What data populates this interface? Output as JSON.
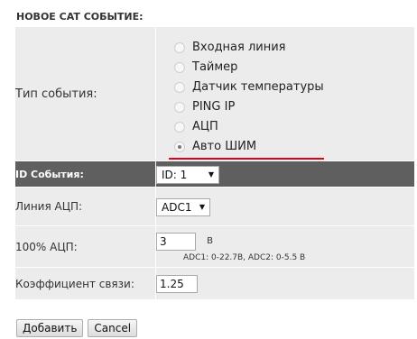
{
  "heading": "НОВОЕ CAT СОБЫТИЕ:",
  "form": {
    "event_type": {
      "label": "Тип события:",
      "options": [
        "Входная линия",
        "Таймер",
        "Датчик температуры",
        "PING IP",
        "АЦП",
        "Авто ШИМ"
      ],
      "selected": "Авто ШИМ"
    },
    "event_id": {
      "label": "ID События:",
      "value": "ID: 1"
    },
    "adc_line": {
      "label": "Линия АЦП:",
      "value": "ADC1"
    },
    "adc_100": {
      "label": "100% АЦП:",
      "value": "3",
      "unit": "В",
      "hint": "ADC1: 0-22.7В, ADC2: 0-5.5 В"
    },
    "coefficient": {
      "label": "Коэффициент связи:",
      "value": "1.25"
    }
  },
  "buttons": {
    "add": "Добавить",
    "cancel": "Cancel"
  },
  "colors": {
    "accent_underline": "#e0001b",
    "header_row": "#5f5f5f",
    "row_bg": "#ececec"
  }
}
